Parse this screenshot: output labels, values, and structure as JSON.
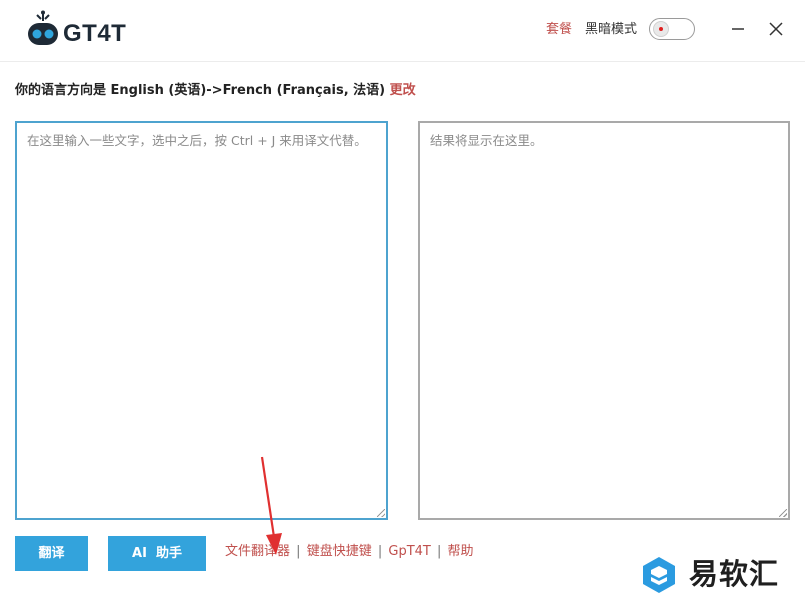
{
  "app": {
    "name": "GT4T"
  },
  "header": {
    "plan_label": "套餐",
    "dark_mode_label": "黑暗模式",
    "dark_mode_on": false
  },
  "language": {
    "prefix": "你的语言方向是 ",
    "direction": "English (英语)->French (Français, 法语)",
    "change_label": "更改"
  },
  "input": {
    "placeholder": "在这里输入一些文字，选中之后，按 Ctrl + J 来用译文代替。",
    "value": ""
  },
  "output": {
    "placeholder": "结果将显示在这里。"
  },
  "buttons": {
    "translate": "翻译",
    "ai_assistant": "AI  助手"
  },
  "links": {
    "file_translator": "文件翻译器",
    "shortcuts": "键盘快捷键",
    "gpt4t": "GpT4T",
    "help": "帮助",
    "separator": "|"
  },
  "watermark": {
    "text": "易软汇"
  },
  "colors": {
    "accent": "#33a3dc",
    "link": "#c0504d",
    "arrow": "#e03030",
    "input_border": "#4ea3cf"
  }
}
